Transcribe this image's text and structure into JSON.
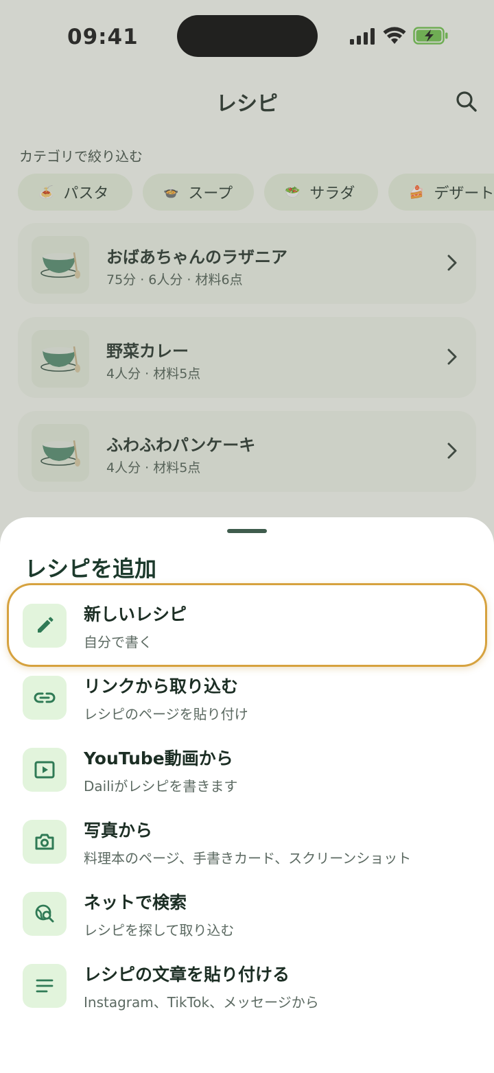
{
  "status": {
    "time": "09:41"
  },
  "nav": {
    "title": "レシピ",
    "search_icon": "search-icon"
  },
  "filter": {
    "label": "カテゴリで絞り込む",
    "chips": [
      {
        "emoji": "🍝",
        "label": "パスタ"
      },
      {
        "emoji": "🍲",
        "label": "スープ"
      },
      {
        "emoji": "🥗",
        "label": "サラダ"
      },
      {
        "emoji": "🍰",
        "label": "デザート"
      }
    ]
  },
  "recipes": [
    {
      "title": "おばあちゃんのラザニア",
      "meta": "75分 · 6人分 · 材料6点"
    },
    {
      "title": "野菜カレー",
      "meta": "4人分 · 材料5点"
    },
    {
      "title": "ふわふわパンケーキ",
      "meta": "4人分 · 材料5点"
    }
  ],
  "sheet": {
    "title": "レシピを追加",
    "options": [
      {
        "icon": "pencil-icon",
        "title": "新しいレシピ",
        "subtitle": "自分で書く"
      },
      {
        "icon": "link-icon",
        "title": "リンクから取り込む",
        "subtitle": "レシピのページを貼り付け"
      },
      {
        "icon": "video-icon",
        "title": "YouTube動画から",
        "subtitle": "Dailiがレシピを書きます"
      },
      {
        "icon": "camera-icon",
        "title": "写真から",
        "subtitle": "料理本のページ、手書きカード、スクリーンショット"
      },
      {
        "icon": "web-search-icon",
        "title": "ネットで検索",
        "subtitle": "レシピを探して取り込む"
      },
      {
        "icon": "text-lines-icon",
        "title": "レシピの文章を貼り付ける",
        "subtitle": "Instagram、TikTok、メッセージから"
      }
    ]
  },
  "colors": {
    "accent": "#2f7a55",
    "icon_bg": "#e2f4dc",
    "highlight": "#d6a23f"
  }
}
